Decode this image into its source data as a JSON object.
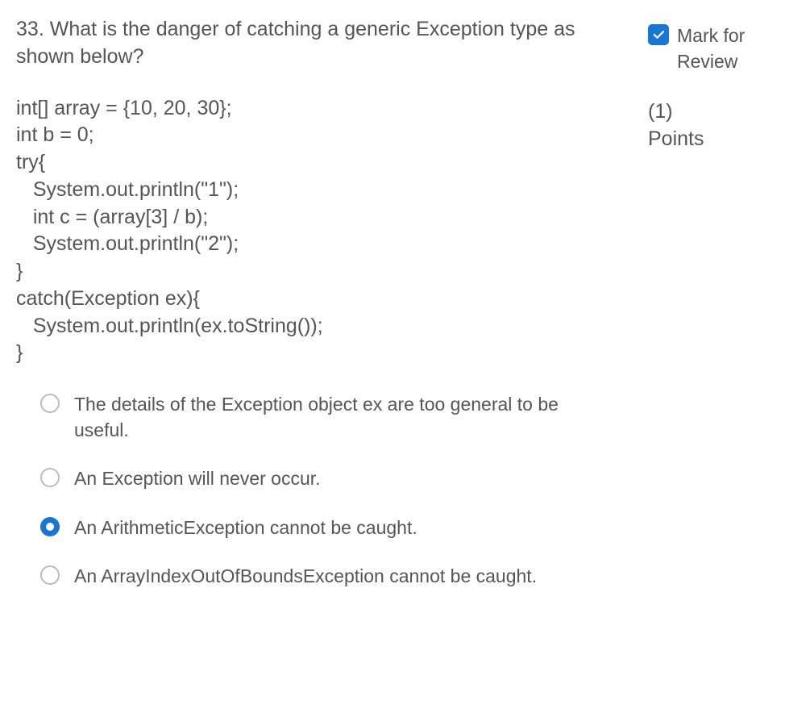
{
  "question": {
    "number": "33",
    "text": "What is the danger of catching a generic Exception type as shown below?",
    "code": "int[] array = {10, 20, 30};\nint b = 0;\ntry{\n   System.out.println(\"1\");\n   int c = (array[3] / b);\n   System.out.println(\"2\");\n}\ncatch(Exception ex){\n   System.out.println(ex.toString());\n}"
  },
  "options": [
    {
      "label": "The details of the Exception object ex are too general to be useful.",
      "selected": false
    },
    {
      "label": "An Exception will never occur.",
      "selected": false
    },
    {
      "label": "An ArithmeticException cannot be caught.",
      "selected": true
    },
    {
      "label": "An ArrayIndexOutOfBoundsException cannot be caught.",
      "selected": false
    }
  ],
  "sidebar": {
    "mark_for_review_label": "Mark for Review",
    "mark_for_review_checked": true,
    "points_value": "(1)",
    "points_label": "Points"
  }
}
